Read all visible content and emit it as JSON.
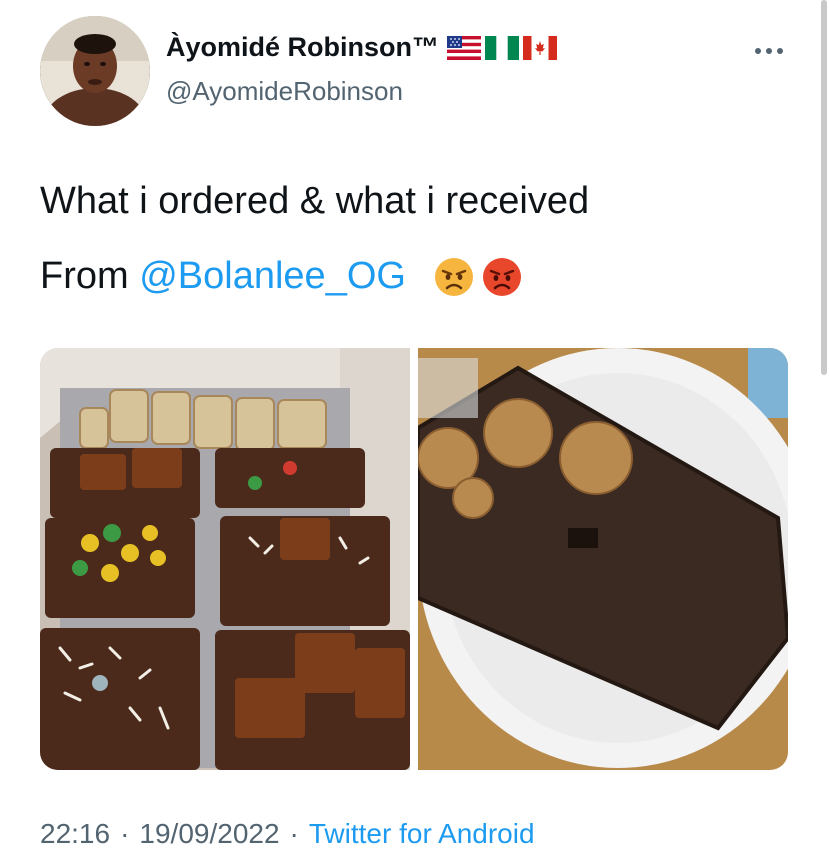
{
  "author": {
    "display_name": "Àyomidé Robinson™",
    "handle": "@AyomideRobinson",
    "flags": [
      "us-flag-icon",
      "nigeria-flag-icon",
      "canada-flag-icon"
    ]
  },
  "tweet": {
    "line1": "What i ordered & what i received",
    "line2_prefix": "From ",
    "mention": "@Bolanlee_OG",
    "emojis": [
      "angry-face-icon",
      "pouting-face-icon"
    ]
  },
  "media": {
    "count": 2
  },
  "meta": {
    "time": "22:16",
    "date": "19/09/2022",
    "separator": "·",
    "source": "Twitter for Android"
  },
  "colors": {
    "text": "#0f1419",
    "secondary": "#536471",
    "link": "#1d9bf0"
  }
}
